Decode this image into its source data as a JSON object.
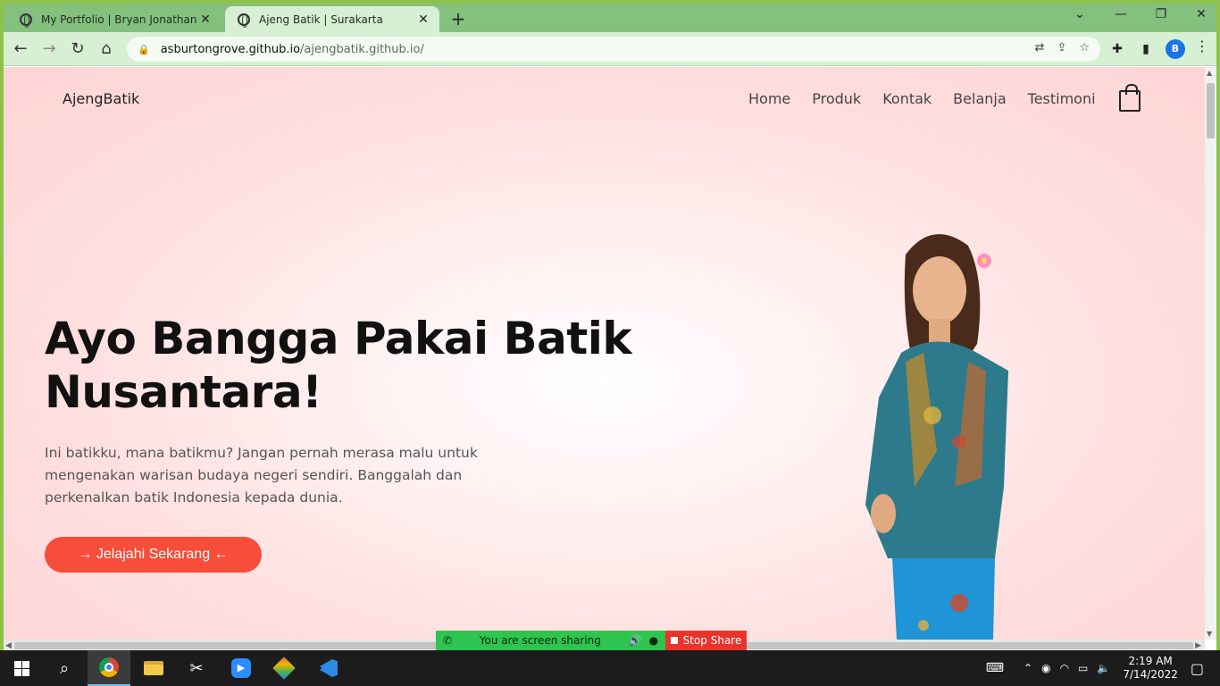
{
  "browser": {
    "tabs": [
      {
        "title": "My Portfolio | Bryan Jonathan",
        "active": false
      },
      {
        "title": "Ajeng Batik | Surakarta",
        "active": true
      }
    ],
    "url_host": "asburtongrove.github.io",
    "url_path": "/ajengbatik.github.io/",
    "profile_initial": "B"
  },
  "site": {
    "brand": "AjengBatik",
    "nav": [
      "Home",
      "Produk",
      "Kontak",
      "Belanja",
      "Testimoni"
    ],
    "hero_title": "Ayo Bangga Pakai Batik Nusantara!",
    "hero_text": "Ini batikku, mana batikmu? Jangan pernah merasa malu untuk mengenakan warisan budaya negeri sendiri. Banggalah dan perkenalkan batik Indonesia kepada dunia.",
    "cta_label": "→ Jelajahi Sekarang ←",
    "colors": {
      "accent": "#f74d3a",
      "background": "#ffd5d6"
    }
  },
  "share_banner": {
    "message": "You are screen sharing",
    "stop_label": "Stop Share"
  },
  "taskbar": {
    "time": "2:19 AM",
    "date": "7/14/2022"
  }
}
